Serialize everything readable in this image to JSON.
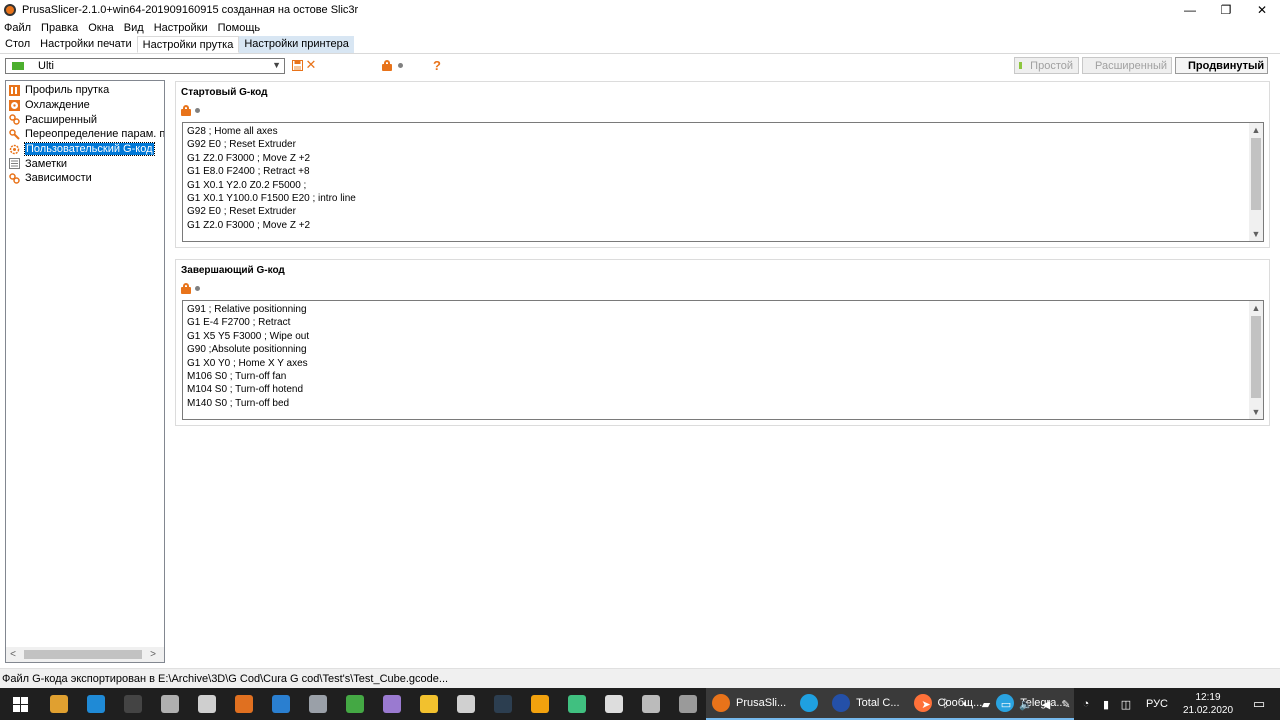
{
  "window": {
    "title": "PrusaSlicer-2.1.0+win64-201909160915 созданная на остове Slic3r",
    "minimize": "—",
    "maximize": "❐",
    "close": "✕"
  },
  "menu": [
    "Файл",
    "Правка",
    "Окна",
    "Вид",
    "Настройки",
    "Помощь"
  ],
  "tabs": [
    {
      "label": "Стол",
      "state": "normal"
    },
    {
      "label": "Настройки печати",
      "state": "normal"
    },
    {
      "label": "Настройки прутка",
      "state": "active"
    },
    {
      "label": "Настройки принтера",
      "state": "highlighted"
    }
  ],
  "toolbar": {
    "preset_value": "Ulti",
    "question": "?",
    "modes": [
      {
        "label": "Простой",
        "color": "#8dc63f",
        "active": false
      },
      {
        "label": "Расширенный",
        "color": "#f2c12e",
        "active": false
      },
      {
        "label": "Продвинутый",
        "color": "#e10000",
        "active": true
      }
    ]
  },
  "tree": {
    "items": [
      {
        "label": "Профиль прутка",
        "icon": "spool-icon",
        "selected": false
      },
      {
        "label": "Охлаждение",
        "icon": "cooling-icon",
        "selected": false
      },
      {
        "label": "Расширенный",
        "icon": "wrench-icon",
        "selected": false
      },
      {
        "label": "Переопределение парам. пру",
        "icon": "wrench-icon",
        "selected": false
      },
      {
        "label": "Пользовательский G-код",
        "icon": "cog-icon",
        "selected": true
      },
      {
        "label": "Заметки",
        "icon": "notes-icon",
        "selected": false
      },
      {
        "label": "Зависимости",
        "icon": "wrench-icon",
        "selected": false
      }
    ]
  },
  "start_gcode": {
    "title": "Стартовый G-код",
    "lines": [
      "G28 ; Home all axes",
      "G92 E0 ; Reset Extruder",
      "G1 Z2.0 F3000 ; Move Z +2",
      "G1 E8.0 F2400 ; Retract +8",
      "G1 X0.1 Y2.0 Z0.2 F5000 ;",
      "G1 X0.1 Y100.0 F1500 E20 ; intro line",
      "G92 E0 ; Reset Extruder",
      "G1 Z2.0 F3000 ; Move Z +2"
    ]
  },
  "end_gcode": {
    "title": "Завершающий G-код",
    "lines": [
      "G91 ; Relative positionning",
      "G1 E-4 F2700 ; Retract",
      "G1 X5 Y5 F3000 ; Wipe out",
      "G90 ;Absolute positionning",
      "G1 X0 Y0 ; Home X Y axes",
      "M106 S0 ; Turn-off fan",
      "M104 S0 ; Turn-off hotend",
      "M140 S0 ; Turn-off bed"
    ]
  },
  "status": {
    "text": "Файл G-кода экспортирован в E:\\Archive\\3D\\G Cod\\Cura G cod\\Test's\\Test_Cube.gcode..."
  },
  "taskbar": {
    "apps": [
      {
        "icon": "app1-icon",
        "color": "#e0a030"
      },
      {
        "icon": "app2-icon",
        "color": "#1f8ad6"
      },
      {
        "icon": "app3-icon",
        "color": "#444444"
      },
      {
        "icon": "app4-icon",
        "color": "#b0b0b0"
      },
      {
        "icon": "app5-icon",
        "color": "#cfcfcf"
      },
      {
        "icon": "app6-icon",
        "color": "#e07020"
      },
      {
        "icon": "app7-icon",
        "color": "#2a7fd0"
      },
      {
        "icon": "app8-icon",
        "color": "#9aa0a8"
      },
      {
        "icon": "app9-icon",
        "color": "#44a844"
      },
      {
        "icon": "app10-icon",
        "color": "#9a7ad0"
      },
      {
        "icon": "folder-icon",
        "color": "#f2c12e"
      },
      {
        "icon": "calculator-icon",
        "color": "#d0d0d0"
      },
      {
        "icon": "app13-icon",
        "color": "#2c3e50"
      },
      {
        "icon": "app14-icon",
        "color": "#f2a20e"
      },
      {
        "icon": "app15-icon",
        "color": "#40c080"
      },
      {
        "icon": "app16-icon",
        "color": "#dddddd"
      },
      {
        "icon": "app17-icon",
        "color": "#bbbbbb"
      },
      {
        "icon": "app18-icon",
        "color": "#9a9a9a"
      }
    ],
    "running": [
      {
        "label": "PrusaSli...",
        "icon": "prusa-icon",
        "color": "#e8731a"
      },
      {
        "label": "",
        "icon": "app-c-icon",
        "color": "#1fa0e0"
      },
      {
        "label": "Total C...",
        "icon": "total-commander-icon",
        "color": "#2450a8"
      },
      {
        "label": "Сообщ...",
        "icon": "firefox-icon",
        "color": "#ff7139"
      },
      {
        "label": "Telegra...",
        "icon": "telegram-icon",
        "color": "#2aa3e0"
      }
    ],
    "lang": "РУС",
    "time": "12:19",
    "date": "21.02.2020"
  }
}
